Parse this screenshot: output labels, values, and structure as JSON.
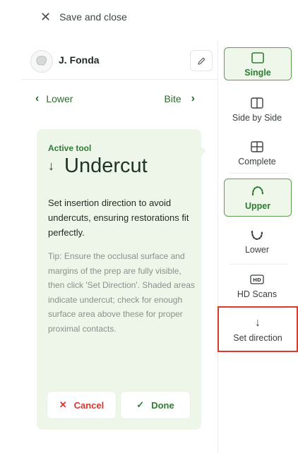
{
  "header": {
    "save_close_label": "Save and close"
  },
  "user": {
    "name": "J. Fonda"
  },
  "nav": {
    "prev_label": "Lower",
    "next_label": "Bite"
  },
  "tool_card": {
    "active_label": "Active tool",
    "tool_name": "Undercut",
    "description": "Set insertion direction to avoid undercuts, ensuring restorations fit perfectly.",
    "tip": "Tip: Ensure the occlusal surface and margins of the prep are fully visible, then click 'Set Direction'. Shaded areas indicate undercut; check for enough surface area above these for proper proximal contacts.",
    "cancel_label": "Cancel",
    "done_label": "Done"
  },
  "sidebar": {
    "view_modes": [
      {
        "label": "Single",
        "icon": "single-view-icon",
        "active": true
      },
      {
        "label": "Side by Side",
        "icon": "side-by-side-icon",
        "active": false
      },
      {
        "label": "Complete",
        "icon": "complete-view-icon",
        "active": false
      }
    ],
    "jaws": [
      {
        "label": "Upper",
        "icon": "upper-jaw-icon",
        "active": true
      },
      {
        "label": "Lower",
        "icon": "lower-jaw-icon",
        "active": false
      }
    ],
    "hd_scans_label": "HD Scans",
    "hd_badge": "HD",
    "set_direction_label": "Set direction"
  },
  "colors": {
    "accent_green": "#2e7d32",
    "active_bg": "#eef7ea",
    "cancel_red": "#d9342b",
    "highlight_red": "#d93a2b",
    "card_bg": "#eef6ea"
  }
}
